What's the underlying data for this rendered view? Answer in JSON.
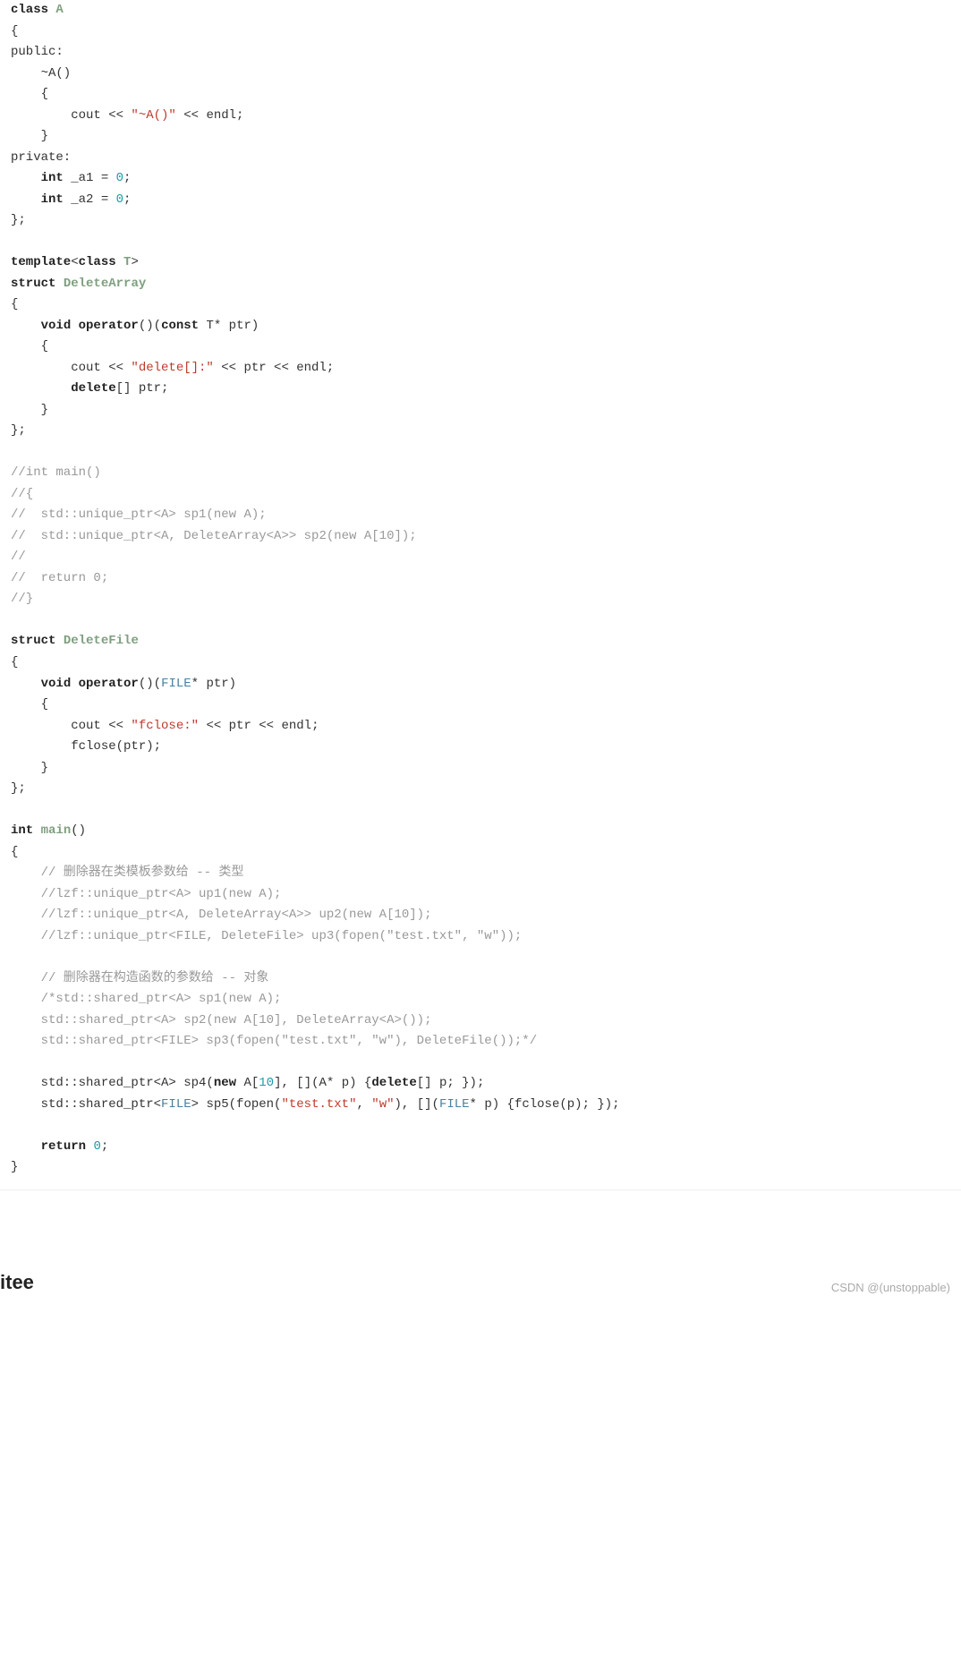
{
  "footer": {
    "left": "itee",
    "right": "CSDN @(unstoppable)"
  },
  "code": {
    "l1": {
      "kw1": "class",
      "id": "A"
    },
    "l2": "{",
    "l3": "public:",
    "l4": "    ~A()",
    "l5": "    {",
    "l6": {
      "pre": "        cout << ",
      "str": "\"~A()\"",
      "post": " << endl;"
    },
    "l7": "    }",
    "l8": "private:",
    "l9": {
      "pre": "    ",
      "kw": "int",
      "mid": " _a1 = ",
      "num": "0",
      "post": ";"
    },
    "l10": {
      "pre": "    ",
      "kw": "int",
      "mid": " _a2 = ",
      "num": "0",
      "post": ";"
    },
    "l11": "};",
    "l13": {
      "kw1": "template",
      "lt": "<",
      "kw2": "class",
      "sp": " ",
      "id": "T",
      "gt": ">"
    },
    "l14": {
      "kw1": "struct",
      "id": "DeleteArray"
    },
    "l15": "{",
    "l16": {
      "pre": "    ",
      "kw1": "void",
      "sp": " ",
      "kw2": "operator",
      "paren": "()(",
      "kw3": "const",
      "mid": " T* ptr)"
    },
    "l17": "    {",
    "l18": {
      "pre": "        cout << ",
      "str": "\"delete[]:\"",
      "post": " << ptr << endl;"
    },
    "l19": {
      "pre": "        ",
      "kw": "delete",
      "post": "[] ptr;"
    },
    "l20": "    }",
    "l21": "};",
    "l23": "//int main()",
    "l24": "//{",
    "l25": "//  std::unique_ptr<A> sp1(new A);",
    "l26": "//  std::unique_ptr<A, DeleteArray<A>> sp2(new A[10]);",
    "l27": "//",
    "l28": "//  return 0;",
    "l29": "//}",
    "l31": {
      "kw1": "struct",
      "id": "DeleteFile"
    },
    "l32": "{",
    "l33": {
      "pre": "    ",
      "kw1": "void",
      "sp": " ",
      "kw2": "operator",
      "paren": "()(",
      "id": "FILE",
      "post": "* ptr)"
    },
    "l34": "    {",
    "l35": {
      "pre": "        cout << ",
      "str": "\"fclose:\"",
      "post": " << ptr << endl;"
    },
    "l36": "        fclose(ptr);",
    "l37": "    }",
    "l38": "};",
    "l40": {
      "kw1": "int",
      "sp": " ",
      "id": "main",
      "post": "()"
    },
    "l41": "{",
    "l42": "    // 删除器在类模板参数给 -- 类型",
    "l43": "    //lzf::unique_ptr<A> up1(new A);",
    "l44": "    //lzf::unique_ptr<A, DeleteArray<A>> up2(new A[10]);",
    "l45": "    //lzf::unique_ptr<FILE, DeleteFile> up3(fopen(\"test.txt\", \"w\"));",
    "l47": "    // 删除器在构造函数的参数给 -- 对象",
    "l48": "    /*std::shared_ptr<A> sp1(new A);",
    "l49": "    std::shared_ptr<A> sp2(new A[10], DeleteArray<A>());",
    "l50": "    std::shared_ptr<FILE> sp3(fopen(\"test.txt\", \"w\"), DeleteFile());*/",
    "l52": {
      "a": "    std::shared_ptr<A> sp4(",
      "kw": "new",
      "b": " A[",
      "num": "10",
      "c": "], [](A* p) {",
      "kw2": "delete",
      "d": "[] p; });"
    },
    "l53": {
      "a": "    std::shared_ptr<",
      "id": "FILE",
      "b": "> sp5(fopen(",
      "str1": "\"test.txt\"",
      "c": ", ",
      "str2": "\"w\"",
      "d": "), [](",
      "id2": "FILE",
      "e": "* p) {fclose(p); });"
    },
    "l55": {
      "pre": "    ",
      "kw": "return",
      "sp": " ",
      "num": "0",
      "post": ";"
    },
    "l56": "}"
  }
}
